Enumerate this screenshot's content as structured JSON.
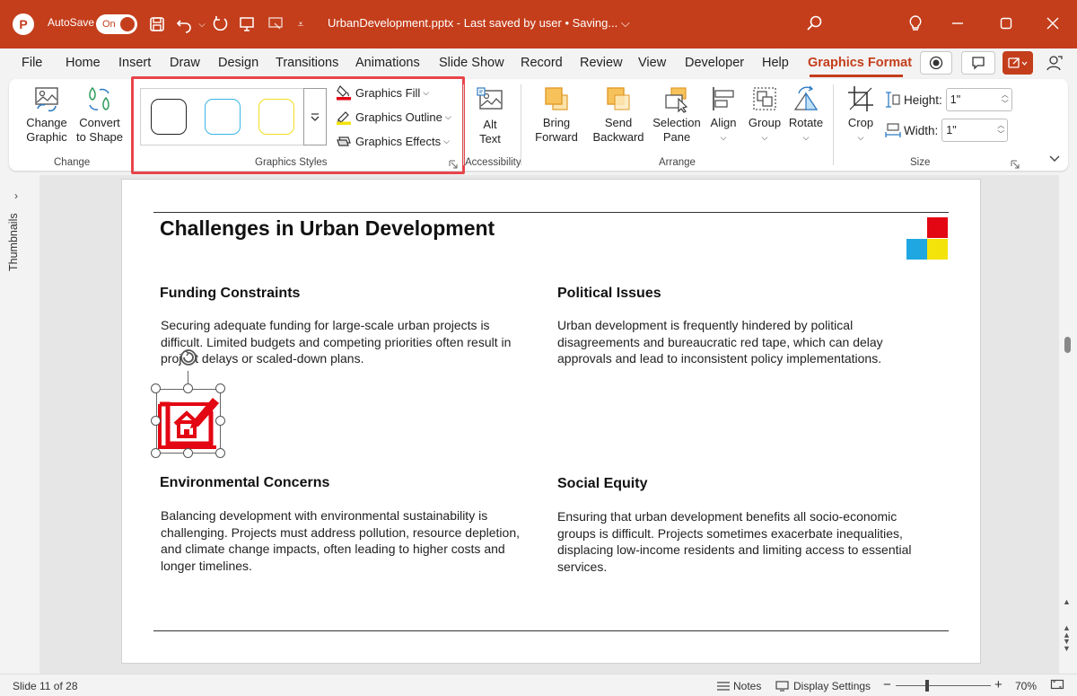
{
  "titlebar": {
    "autosave_label": "AutoSave",
    "autosave_state": "On",
    "document_title": "UrbanDevelopment.pptx  -  Last saved by user  •  Saving...  ⌵",
    "accent_color": "#c43e1c"
  },
  "tabs": [
    "File",
    "Home",
    "Insert",
    "Draw",
    "Design",
    "Transitions",
    "Animations",
    "Slide Show",
    "Record",
    "Review",
    "View",
    "Developer",
    "Help",
    "Graphics Format"
  ],
  "active_tab": "Graphics Format",
  "ribbon": {
    "change_graphic": "Change Graphic",
    "convert_to_shape": "Convert to Shape",
    "group_change": "Change",
    "graphics_fill": "Graphics Fill",
    "graphics_outline": "Graphics Outline",
    "graphics_effects": "Graphics Effects",
    "group_graphics_styles": "Graphics Styles",
    "alt_text": "Alt Text",
    "group_accessibility": "Accessibility",
    "bring_forward": "Bring Forward",
    "send_backward": "Send Backward",
    "selection_pane": "Selection Pane",
    "align": "Align",
    "group": "Group",
    "rotate": "Rotate",
    "group_arrange": "Arrange",
    "crop": "Crop",
    "height_label": "Height:",
    "height_value": "1\"",
    "width_label": "Width:",
    "width_value": "1\"",
    "group_size": "Size",
    "style_colors": [
      "#222222",
      "#3ab5e6",
      "#f2de1e"
    ]
  },
  "thumbnails_label": "Thumbnails",
  "slide": {
    "title": "Challenges in Urban Development",
    "sections": [
      {
        "heading": "Funding Constraints",
        "body": "Securing adequate funding for large-scale urban projects is difficult. Limited budgets and competing priorities often result in project delays or scaled-down plans."
      },
      {
        "heading": "Political Issues",
        "body": "Urban development is frequently hindered by political disagreements and bureaucratic red tape, which can delay approvals and lead to inconsistent policy implementations."
      },
      {
        "heading": "Environmental Concerns",
        "body": "Balancing development with environmental sustainability is challenging. Projects must address pollution, resource depletion, and climate change impacts, often leading to higher costs and longer timelines."
      },
      {
        "heading": "Social Equity",
        "body": "Ensuring that urban development benefits all socio-economic groups is difficult. Projects sometimes exacerbate inequalities, displacing low-income residents and limiting access to essential services."
      }
    ],
    "logo_colors": [
      "#e30613",
      "#1ea7e1",
      "#f4e20b"
    ],
    "icon_color": "#e30613"
  },
  "statusbar": {
    "slide_info": "Slide 11 of 28",
    "notes": "Notes",
    "display_settings": "Display Settings",
    "zoom_minus": "−",
    "zoom_plus": "+",
    "zoom": "70%"
  }
}
